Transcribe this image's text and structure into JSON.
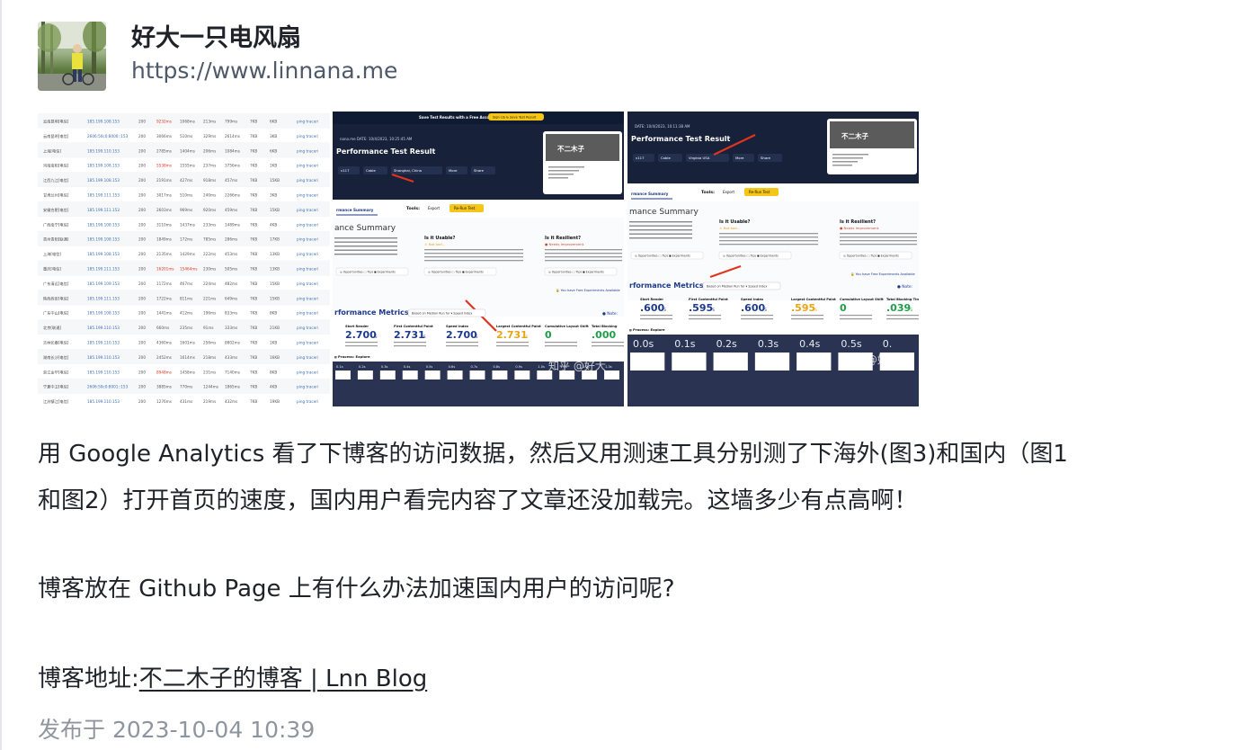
{
  "author": {
    "name": "好大一只电风扇",
    "url": "https://www.linnana.me"
  },
  "images": [
    {
      "title": "test-table-screenshot",
      "rows": [
        {
          "loc": "云南昆明[电信]",
          "ip": "185.199.108.153",
          "code": "200",
          "t1": "9232ms",
          "t2": "1068ms",
          "t3": "213ms",
          "t4": "799ms",
          "s1": "7KB",
          "s2": "6KB",
          "a": "ping traceri"
        },
        {
          "loc": "云南昆明[电信]",
          "ip": "2606:50c0:8000::153",
          "code": "200",
          "t1": "3066ms",
          "t2": "510ms",
          "t3": "329ms",
          "t4": "2614ms",
          "s1": "7KB",
          "s2": "3KB",
          "a": "ping traceri"
        },
        {
          "loc": "上海[电信]",
          "ip": "185.199.110.153",
          "code": "200",
          "t1": "2785ms",
          "t2": "1404ms",
          "t3": "206ms",
          "t4": "1084ms",
          "s1": "7KB",
          "s2": "6KB",
          "a": "ping traceri"
        },
        {
          "loc": "河南南阳[电信]",
          "ip": "185.199.108.153",
          "code": "200",
          "t1": "5538ms",
          "t2": "1555ms",
          "t3": "237ms",
          "t4": "3756ms",
          "s1": "7KB",
          "s2": "1KB",
          "a": "ping traceri"
        },
        {
          "loc": "江西九江[电信]",
          "ip": "185.199.108.153",
          "code": "200",
          "t1": "2191ms",
          "t2": "427ms",
          "t3": "918ms",
          "t4": "457ms",
          "s1": "7KB",
          "s2": "15KB",
          "a": "ping traceri"
        },
        {
          "loc": "甘肃兰州[电信]",
          "ip": "185.199.111.153",
          "code": "200",
          "t1": "3017ms",
          "t2": "510ms",
          "t3": "240ms",
          "t4": "2266ms",
          "s1": "7KB",
          "s2": "3KB",
          "a": "ping traceri"
        },
        {
          "loc": "安徽合肥[电信]",
          "ip": "185.199.111.153",
          "code": "200",
          "t1": "2603ms",
          "t2": "969ms",
          "t3": "920ms",
          "t4": "459ms",
          "s1": "7KB",
          "s2": "15KB",
          "a": "ping traceri"
        },
        {
          "loc": "广西南宁[电信]",
          "ip": "185.199.108.153",
          "code": "200",
          "t1": "3110ms",
          "t2": "1437ms",
          "t3": "233ms",
          "t4": "1489ms",
          "s1": "7KB",
          "s2": "4KB",
          "a": "ping traceri"
        },
        {
          "loc": "贵州贵阳[联通]",
          "ip": "185.199.108.153",
          "code": "200",
          "t1": "1849ms",
          "t2": "172ms",
          "t3": "785ms",
          "t4": "286ms",
          "s1": "7KB",
          "s2": "17KB",
          "a": "ping traceri"
        },
        {
          "loc": "上海[电信]",
          "ip": "185.199.108.153",
          "code": "200",
          "t1": "2135ms",
          "t2": "1429ms",
          "t3": "222ms",
          "t4": "453ms",
          "s1": "7KB",
          "s2": "13KB",
          "a": "ping traceri"
        },
        {
          "loc": "重庆[电信]",
          "ip": "185.199.111.153",
          "code": "200",
          "t1": "16201ms",
          "t2": "15464ms",
          "t3": "230ms",
          "t4": "505ms",
          "s1": "7KB",
          "s2": "13KB",
          "a": "ping traceri"
        },
        {
          "loc": "广东清远[电信]",
          "ip": "185.199.109.153",
          "code": "200",
          "t1": "1172ms",
          "t2": "467ms",
          "t3": "224ms",
          "t4": "482ms",
          "s1": "7KB",
          "s2": "15KB",
          "a": "ping traceri"
        },
        {
          "loc": "陕西西安[电信]",
          "ip": "185.199.111.153",
          "code": "200",
          "t1": "1722ms",
          "t2": "811ms",
          "t3": "221ms",
          "t4": "649ms",
          "s1": "7KB",
          "s2": "15KB",
          "a": "ping traceri"
        },
        {
          "loc": "广东中山[电信]",
          "ip": "185.199.108.153",
          "code": "200",
          "t1": "1441ms",
          "t2": "412ms",
          "t3": "196ms",
          "t4": "833ms",
          "s1": "7KB",
          "s2": "8KB",
          "a": "ping traceri"
        },
        {
          "loc": "北京[联通]",
          "ip": "185.199.110.153",
          "code": "200",
          "t1": "660ms",
          "t2": "235ms",
          "t3": "91ms",
          "t4": "333ms",
          "s1": "7KB",
          "s2": "21KB",
          "a": "ping traceri"
        },
        {
          "loc": "吉林长春[电信]",
          "ip": "185.199.110.153",
          "code": "200",
          "t1": "4360ms",
          "t2": "1601ms",
          "t3": "256ms",
          "t4": "8802ms",
          "s1": "7KB",
          "s2": "1KB",
          "a": "ping traceri"
        },
        {
          "loc": "湖南长沙[电信]",
          "ip": "185.199.110.153",
          "code": "200",
          "t1": "2452ms",
          "t2": "1614ms",
          "t3": "218ms",
          "t4": "433ms",
          "s1": "7KB",
          "s2": "16KB",
          "a": "ping traceri"
        },
        {
          "loc": "浙江金华[电信]",
          "ip": "185.199.110.153",
          "code": "200",
          "t1": "8948ms",
          "t2": "1458ms",
          "t3": "231ms",
          "t4": "7140ms",
          "s1": "7KB",
          "s2": "8KB",
          "a": "ping traceri"
        },
        {
          "loc": "宁夏中卫[电信]",
          "ip": "2606:50c0:8001::153",
          "code": "200",
          "t1": "3885ms",
          "t2": "770ms",
          "t3": "1244ms",
          "t4": "1865ms",
          "s1": "7KB",
          "s2": "4KB",
          "a": "ping traceri"
        },
        {
          "loc": "江苏镇江[电信]",
          "ip": "185.199.110.153",
          "code": "200",
          "t1": "1276ms",
          "t2": "431ms",
          "t3": "219ms",
          "t4": "432ms",
          "s1": "7KB",
          "s2": "19KB",
          "a": "ping traceri"
        }
      ]
    },
    {
      "banner": "Save Test Results with a Free Account",
      "banner_btn": "Sign Up & Save Test Result",
      "date": "DATE: 10/4/2023, 10:25:45 AM",
      "heading": "Performance Test Result",
      "chips": [
        "v117",
        "Cable",
        "Shanghai, China",
        "More",
        "Share"
      ],
      "preview_title": "不二木子",
      "tools": "Tools:",
      "export": "Export",
      "rerun": "Re-Run Test",
      "summary_nav": "rmance Summary",
      "summary_title": "ance Summary",
      "usable_title": "Is it Usable?",
      "usable_tag": "Not bad...",
      "resilient_title": "Is it Resilient?",
      "resilient_tag": "Needs Improvement.",
      "opps": "Opportunities",
      "tips": "Tips",
      "exps": "Experiments",
      "free_exp": "You have Free Experiments Available",
      "metrics_title": "rformance Metrics",
      "metrics_note": "Based on Median Run for",
      "speed_index": "Speed Index",
      "metrics": [
        {
          "label": "Start Render",
          "value": "2.700",
          "unit": "S"
        },
        {
          "label": "First Contentful Paint",
          "value": "2.731",
          "unit": "S"
        },
        {
          "label": "Speed Index",
          "value": "2.700",
          "unit": "S"
        },
        {
          "label": "Largest Contentful Paint",
          "value": "2.731",
          "unit": "S"
        },
        {
          "label": "Cumulative Layout Shift",
          "value": "0",
          "unit": ""
        },
        {
          "label": "Total Blocking",
          "value": ".000",
          "unit": ""
        }
      ],
      "note": "Note:",
      "process": "g Process",
      "explore": "Explore",
      "filmstrip": [
        "0.1s",
        "0.2s",
        "0.3s",
        "0.4s",
        "0.5s",
        "0.6s",
        "0.7s",
        "0.8s",
        "0.9s",
        "1.0s",
        "1.1s",
        "1.2s",
        "1.3s"
      ],
      "watermark": "知乎 @好大"
    },
    {
      "date": "DATE: 10/4/2023, 10:11:38 AM",
      "heading": "Performance Test Result",
      "chips": [
        "v117",
        "Cable",
        "Virginia USA",
        "More",
        "Share"
      ],
      "preview_title": "不二木子",
      "tools": "Tools:",
      "export": "Export",
      "rerun": "Re-Run Test",
      "summary_nav": "rmance Summary",
      "summary_title": "mance Summary",
      "usable_title": "Is it Usable?",
      "usable_tag": "Not bad...",
      "resilient_title": "Is it Resilient?",
      "resilient_tag": "Needs Improvement.",
      "opps": "Opportunities",
      "tips": "Tips",
      "exps": "Experiments",
      "free_exp": "You have Free Experiments Available",
      "metrics_title": "rformance Metrics",
      "metrics_note": "Based on Median Run for",
      "speed_index": "Speed Index",
      "metrics": [
        {
          "label": "Start Render",
          "value": ".600",
          "unit": "S"
        },
        {
          "label": "First Contentful Paint",
          "value": ".595",
          "unit": "S"
        },
        {
          "label": "Speed Index",
          "value": ".600",
          "unit": "S"
        },
        {
          "label": "Largest Contentful Paint",
          "value": ".595",
          "unit": "S"
        },
        {
          "label": "Cumulative Layout Shift",
          "value": "0",
          "unit": ""
        },
        {
          "label": "Total Blocking Time",
          "value": ".039",
          "unit": "S"
        }
      ],
      "note": "Note:",
      "process": "g Process",
      "explore": "Explore",
      "filmstrip": [
        "0.0s",
        "0.1s",
        "0.2s",
        "0.3s",
        "0.4s",
        "0.5s",
        "0."
      ],
      "watermark": "知乎 @好大一"
    }
  ],
  "content": {
    "line1": "用 Google Analytics 看了下博客的访问数据，然后又用测速工具分别测了下海外(图3)和国内（图1",
    "line2": "和图2）打开首页的速度，国内用户看完内容了文章还没加载完。这墙多少有点高啊！",
    "line3": "博客放在 Github Page 上有什么办法加速国内用户的访问呢?",
    "line4_prefix": "博客地址:",
    "line4_link": "不二木子的博客 | Lnn Blog"
  },
  "post_time": "发布于 2023-10-04 10:39",
  "colors": {
    "text": "#1f2329",
    "muted": "#8f959e",
    "url": "#4e5969",
    "wpt_dark": "#17213a",
    "wpt_yellow": "#f5c518",
    "arrow_red": "#e0341e",
    "fast_blue": "#1d3a8a",
    "slow_orange": "#e8a317",
    "good_green": "#1f9e48"
  }
}
